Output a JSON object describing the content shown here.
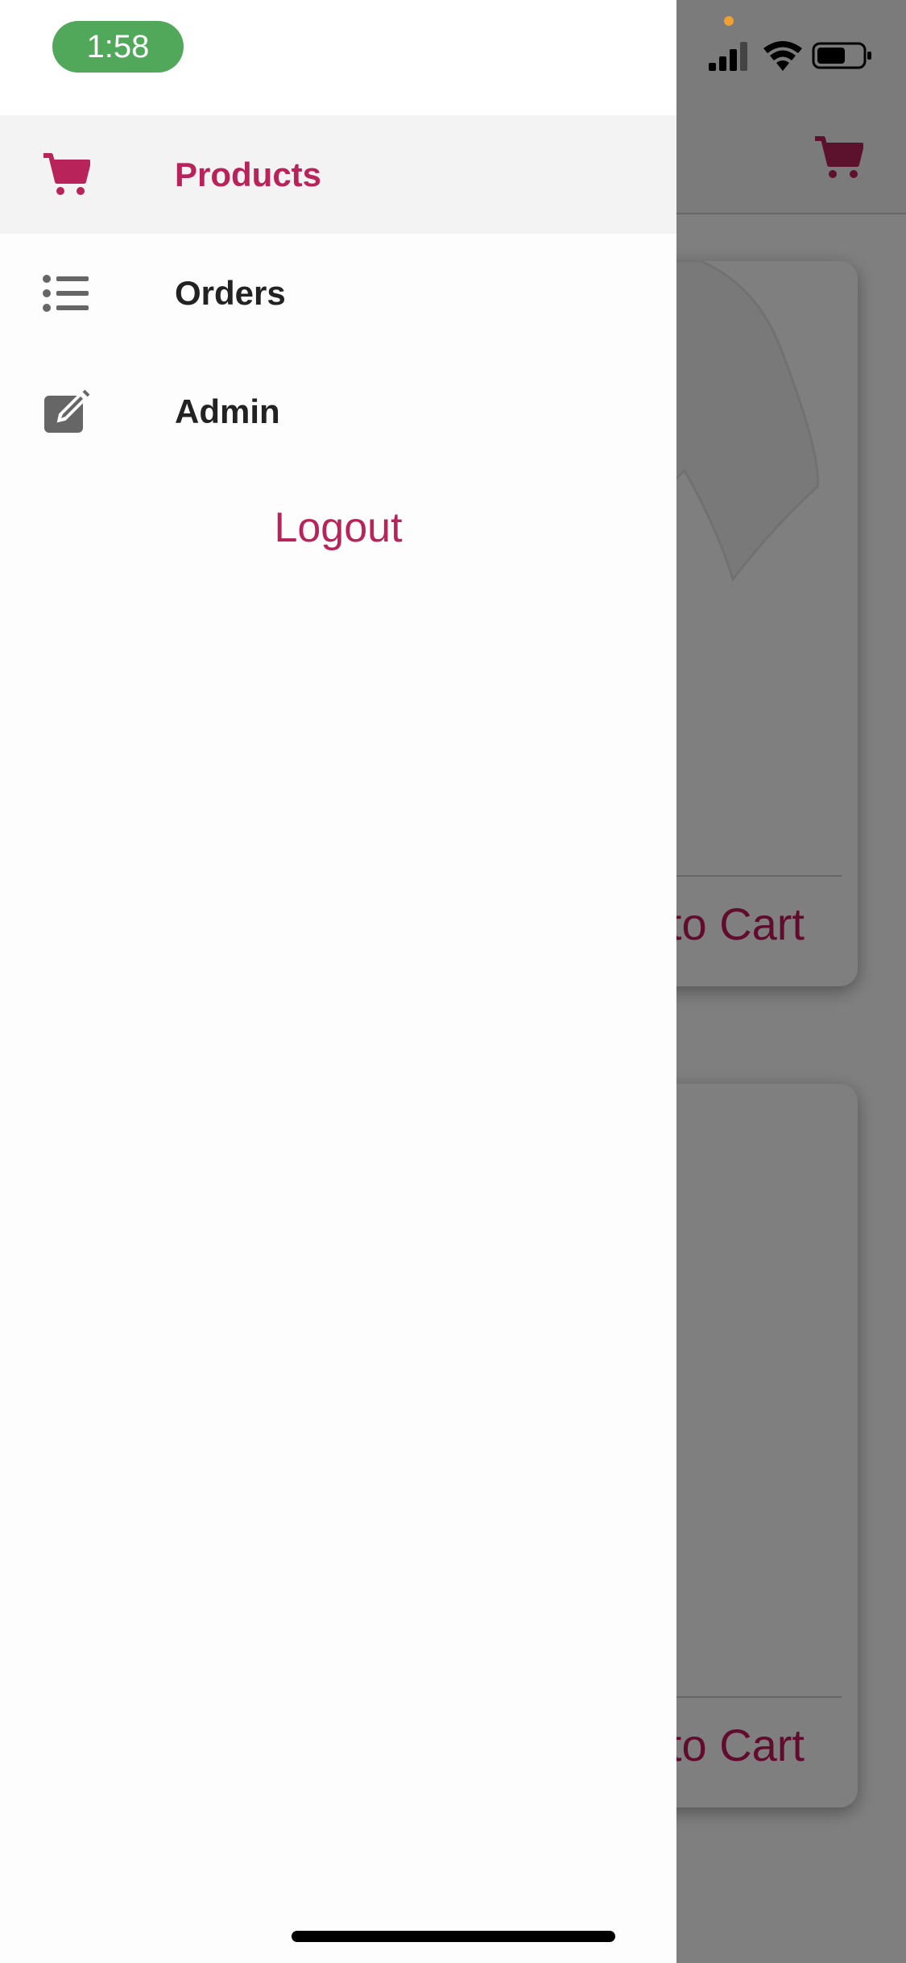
{
  "status_bar": {
    "time": "1:58",
    "time_pill_color": "#51a85a",
    "icons": [
      "cellular-signal-icon",
      "wifi-icon",
      "battery-icon"
    ]
  },
  "drawer": {
    "items": [
      {
        "label": "Products",
        "icon": "cart-icon",
        "active": true
      },
      {
        "label": "Orders",
        "icon": "list-icon",
        "active": false
      },
      {
        "label": "Admin",
        "icon": "edit-icon",
        "active": false
      }
    ],
    "logout_label": "Logout",
    "accent_color": "#b8245a"
  },
  "background_app": {
    "header_icon": "cart-icon",
    "cards": [
      {
        "button_label": "Add to Cart"
      },
      {
        "button_label": "Add to Cart"
      }
    ]
  }
}
